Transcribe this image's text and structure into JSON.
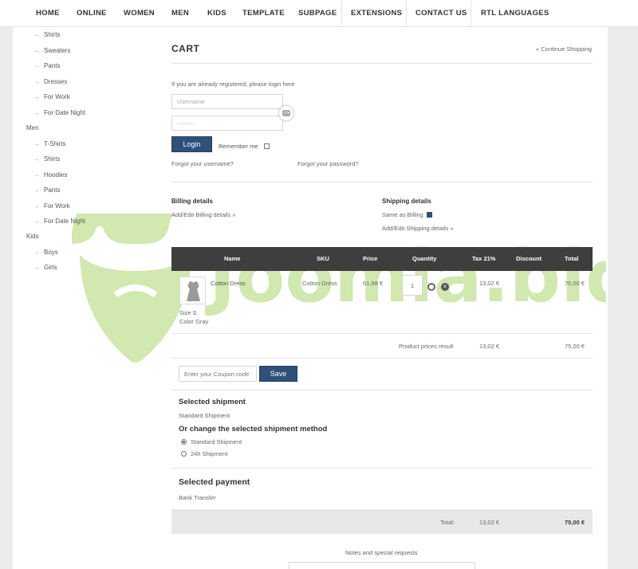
{
  "nav": {
    "items": [
      "HOME",
      "ONLINE",
      "WOMEN",
      "MEN",
      "KIDS",
      "TEMPLATE",
      "SUBPAGE",
      "EXTENSIONS",
      "CONTACT US",
      "RTL LANGUAGES"
    ]
  },
  "sidebar": {
    "women_items": [
      "Shirts",
      "Sweaters",
      "Pants",
      "Dresses",
      "For Work",
      "For Date Night"
    ],
    "men_label": "Men",
    "men_items": [
      "T-Shirts",
      "Shirts",
      "Hoodies",
      "Pants",
      "For Work",
      "For Date Night"
    ],
    "kids_label": "Kids",
    "kids_items": [
      "Boys",
      "Girls"
    ]
  },
  "cart": {
    "title": "CART",
    "continue_link": "« Continue Shopping",
    "login_prompt": "If you are already registered, please login here",
    "username_placeholder": "Username",
    "password_value": "·········",
    "login_button": "Login",
    "remember_me": "Remember me",
    "forgot_username": "Forgot your username?",
    "forgot_password": "Forgot your password?"
  },
  "billing": {
    "title": "Billing details",
    "link": "Add/Edit Billing details »"
  },
  "shipping": {
    "title": "Shipping details",
    "same_as_billing": "Same as Billing",
    "link": "Add/Edit Shipping details »"
  },
  "table": {
    "headers": {
      "name": "Name",
      "sku": "SKU",
      "price": "Price",
      "quantity": "Quantity",
      "tax": "Tax 21%",
      "discount": "Discount",
      "total": "Total"
    },
    "row": {
      "name": "Cotton Dress",
      "sku": "Cotton Dress",
      "price": "61,98 €",
      "quantity": "1",
      "tax": "13,02 €",
      "total": "75,00 €",
      "size": "Size S",
      "color": "Color Gray"
    },
    "product_prices_label": "Product prices result",
    "product_prices_tax": "13,02 €",
    "product_prices_total": "75,00 €"
  },
  "coupon": {
    "placeholder": "Enter your Coupon code",
    "save_button": "Save"
  },
  "shipment": {
    "selected_title": "Selected shipment",
    "selected_value": "Standard Shipment",
    "change_title": "Or change the selected shipment method",
    "options": [
      "Standard Shipment",
      "24h Shipment"
    ]
  },
  "payment": {
    "selected_title": "Selected payment",
    "selected_value": "Bank Transfer"
  },
  "totals": {
    "label": "Total:",
    "tax": "13,02 €",
    "total": "75,00 €"
  },
  "notes": {
    "label": "Notes and special requests"
  },
  "watermark": {
    "text": "Joomla.bid"
  },
  "colors": {
    "accent": "#2e5079",
    "table_header": "#3e3e3e",
    "watermark": "#c9e5a3"
  }
}
